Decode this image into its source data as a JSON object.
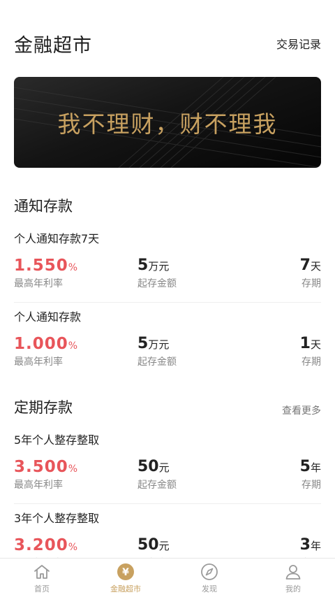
{
  "header": {
    "title": "金融超市",
    "link": "交易记录"
  },
  "banner": {
    "text": "我不理财，财不理我"
  },
  "sections": {
    "notice": {
      "title": "通知存款"
    },
    "fixed": {
      "title": "定期存款",
      "more": "查看更多"
    }
  },
  "labels": {
    "rate": "最高年利率",
    "amount": "起存金额",
    "term": "存期"
  },
  "products": [
    {
      "name": "个人通知存款7天",
      "rate": "1.550",
      "rate_unit": "%",
      "amount": "5",
      "amount_unit": "万元",
      "term": "7",
      "term_unit": "天"
    },
    {
      "name": "个人通知存款",
      "rate": "1.000",
      "rate_unit": "%",
      "amount": "5",
      "amount_unit": "万元",
      "term": "1",
      "term_unit": "天"
    },
    {
      "name": "5年个人整存整取",
      "rate": "3.500",
      "rate_unit": "%",
      "amount": "50",
      "amount_unit": "元",
      "term": "5",
      "term_unit": "年"
    },
    {
      "name": "3年个人整存整取",
      "rate": "3.200",
      "rate_unit": "%",
      "amount": "50",
      "amount_unit": "元",
      "term": "3",
      "term_unit": "年"
    }
  ],
  "tabbar": {
    "items": [
      {
        "label": "首页",
        "icon": "home-icon"
      },
      {
        "label": "金融超市",
        "icon": "yen-coin-icon"
      },
      {
        "label": "发现",
        "icon": "compass-icon"
      },
      {
        "label": "我的",
        "icon": "user-icon"
      }
    ],
    "active_color": "#c8a160",
    "inactive_color": "#9a9a9a"
  },
  "colors": {
    "rate": "#e8555a",
    "gold": "#c8a160"
  }
}
